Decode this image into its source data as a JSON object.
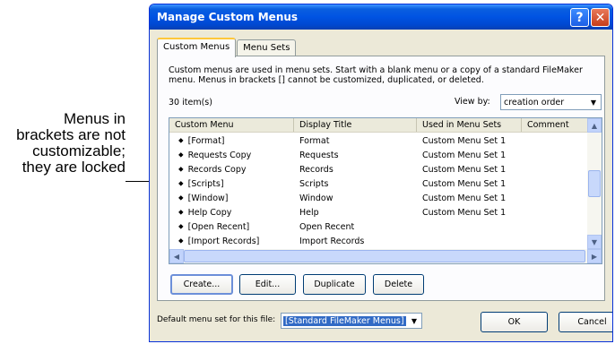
{
  "callout": {
    "lines": [
      "Menus in",
      "brackets are not",
      "customizable;",
      "they are locked"
    ]
  },
  "window": {
    "title": "Manage Custom Menus",
    "help_glyph": "?",
    "close_glyph": "✕"
  },
  "tabs": [
    {
      "label": "Custom Menus"
    },
    {
      "label": "Menu Sets"
    }
  ],
  "description": "Custom menus are used in menu sets. Start with a blank menu or a copy of a standard FileMaker menu. Menus in brackets [] cannot be customized, duplicated, or deleted.",
  "item_count": "30 item(s)",
  "view_by": {
    "label": "View by:",
    "value": "creation order"
  },
  "list": {
    "columns": [
      "Custom Menu",
      "Display Title",
      "Used in Menu Sets",
      "Comment"
    ],
    "rows": [
      {
        "menu": "[Format]",
        "title": "Format",
        "sets": "Custom Menu Set 1"
      },
      {
        "menu": "Requests Copy",
        "title": "Requests",
        "sets": "Custom Menu Set 1"
      },
      {
        "menu": "Records Copy",
        "title": "Records",
        "sets": "Custom Menu Set 1"
      },
      {
        "menu": "[Scripts]",
        "title": "Scripts",
        "sets": "Custom Menu Set 1"
      },
      {
        "menu": "[Window]",
        "title": "Window",
        "sets": "Custom Menu Set 1"
      },
      {
        "menu": "Help Copy",
        "title": "Help",
        "sets": "Custom Menu Set 1"
      },
      {
        "menu": "[Open Recent]",
        "title": "Open Recent",
        "sets": ""
      },
      {
        "menu": "[Import Records]",
        "title": "Import Records",
        "sets": ""
      }
    ]
  },
  "buttons": {
    "create": "Create...",
    "edit": "Edit...",
    "duplicate": "Duplicate",
    "delete": "Delete",
    "ok": "OK",
    "cancel": "Cancel"
  },
  "default_menu_set": {
    "label": "Default menu set for this file:",
    "value": "[Standard FileMaker Menus]"
  }
}
